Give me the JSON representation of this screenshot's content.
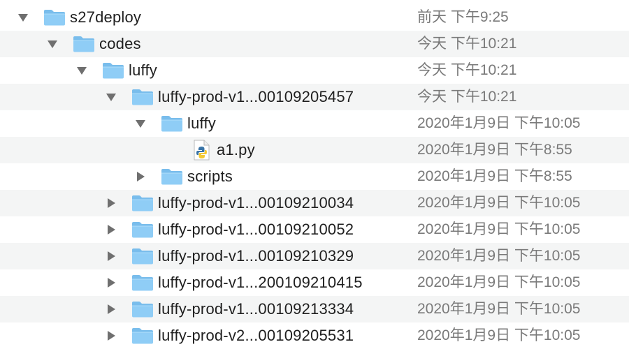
{
  "window": {
    "view": "list"
  },
  "colors": {
    "folder_fill": "#8fcdf6",
    "folder_tab": "#79bdec",
    "disclosure": "#6f6f6f",
    "date_text": "#7a7a7a",
    "name_text": "#1f1f1f",
    "stripe": "#f4f5f5"
  },
  "rows": [
    {
      "name": "s27deploy",
      "date": "前天 下午9:25",
      "type": "folder",
      "icon": "folder-icon",
      "expanded": true,
      "depth": 0
    },
    {
      "name": "codes",
      "date": "今天 下午10:21",
      "type": "folder",
      "icon": "folder-icon",
      "expanded": true,
      "depth": 1
    },
    {
      "name": "luffy",
      "date": "今天 下午10:21",
      "type": "folder",
      "icon": "folder-icon",
      "expanded": true,
      "depth": 2
    },
    {
      "name": "luffy-prod-v1...00109205457",
      "date": "今天 下午10:21",
      "type": "folder",
      "icon": "folder-icon",
      "expanded": true,
      "depth": 3
    },
    {
      "name": "luffy",
      "date": "2020年1月9日 下午10:05",
      "type": "folder",
      "icon": "folder-icon",
      "expanded": true,
      "depth": 4
    },
    {
      "name": "a1.py",
      "date": "2020年1月9日 下午8:55",
      "type": "file",
      "icon": "python-file-icon",
      "expanded": null,
      "depth": 5
    },
    {
      "name": "scripts",
      "date": "2020年1月9日 下午8:55",
      "type": "folder",
      "icon": "folder-icon",
      "expanded": false,
      "depth": 4
    },
    {
      "name": "luffy-prod-v1...00109210034",
      "date": "2020年1月9日 下午10:05",
      "type": "folder",
      "icon": "folder-icon",
      "expanded": false,
      "depth": 3
    },
    {
      "name": "luffy-prod-v1...00109210052",
      "date": "2020年1月9日 下午10:05",
      "type": "folder",
      "icon": "folder-icon",
      "expanded": false,
      "depth": 3
    },
    {
      "name": "luffy-prod-v1...00109210329",
      "date": "2020年1月9日 下午10:05",
      "type": "folder",
      "icon": "folder-icon",
      "expanded": false,
      "depth": 3
    },
    {
      "name": "luffy-prod-v1...200109210415",
      "date": "2020年1月9日 下午10:05",
      "type": "folder",
      "icon": "folder-icon",
      "expanded": false,
      "depth": 3
    },
    {
      "name": "luffy-prod-v1...00109213334",
      "date": "2020年1月9日 下午10:05",
      "type": "folder",
      "icon": "folder-icon",
      "expanded": false,
      "depth": 3
    },
    {
      "name": "luffy-prod-v2...00109205531",
      "date": "2020年1月9日 下午10:05",
      "type": "folder",
      "icon": "folder-icon",
      "expanded": false,
      "depth": 3
    }
  ]
}
